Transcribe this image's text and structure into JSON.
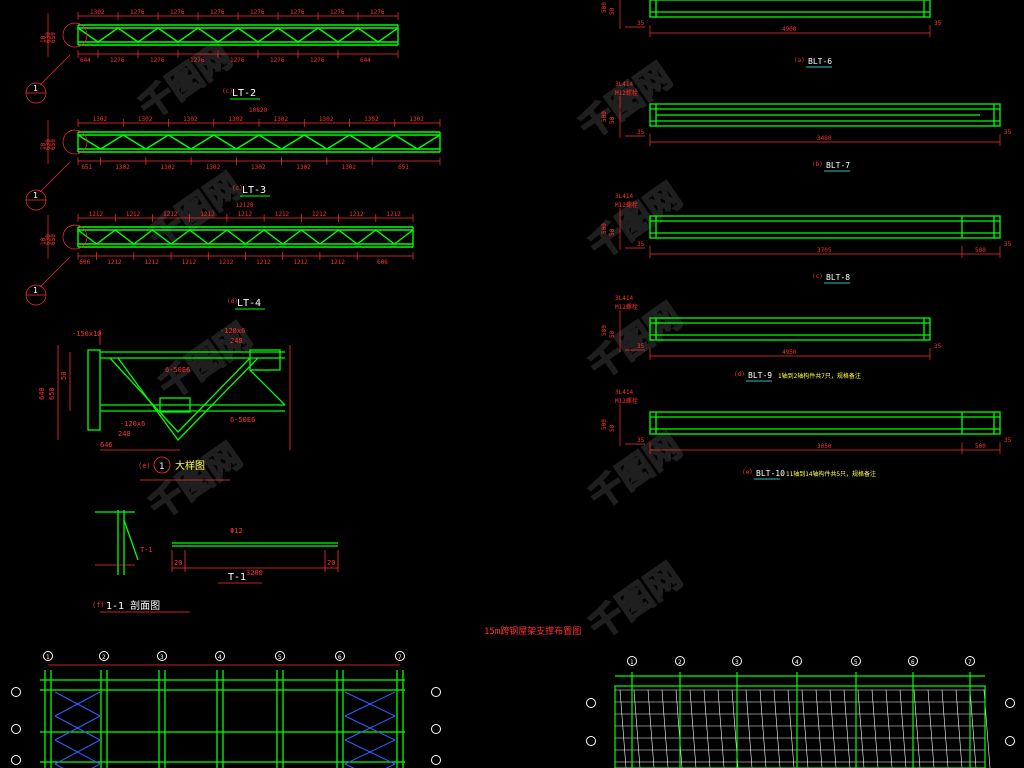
{
  "colors": {
    "background": "#000000",
    "truss": "#00ff00",
    "dimension": "#ff3030",
    "label": "#ffffff",
    "note": "#ffff40",
    "grid": "#40ffff",
    "bracing": "#3060ff"
  },
  "trusses": [
    {
      "label": "LT-2",
      "prefix": "(c)",
      "top_dims": [
        "1302",
        "1276",
        "1276",
        "1276",
        "1276",
        "1276",
        "1276",
        "1276"
      ],
      "bottom_dims": [
        "644",
        "1276",
        "1276",
        "1276",
        "1276",
        "1276",
        "1276",
        "644"
      ],
      "total": "",
      "height_dims": [
        "10",
        "630",
        "650"
      ]
    },
    {
      "label": "LT-3",
      "prefix": "(c)",
      "top_dims": [
        "1302",
        "1302",
        "1302",
        "1302",
        "1302",
        "1302",
        "1302",
        "1302"
      ],
      "bottom_dims": [
        "651",
        "1302",
        "1302",
        "1302",
        "1302",
        "1302",
        "1302",
        "651"
      ],
      "total": "10820",
      "height_dims": [
        "10",
        "630",
        "650"
      ]
    },
    {
      "label": "LT-4",
      "prefix": "(d)",
      "top_dims": [
        "1212",
        "1212",
        "1212",
        "1212",
        "1212",
        "1212",
        "1212",
        "1212",
        "1212"
      ],
      "bottom_dims": [
        "606",
        "1212",
        "1212",
        "1212",
        "1212",
        "1212",
        "1212",
        "1212",
        "606"
      ],
      "total": "12120",
      "height_dims": [
        "10",
        "630",
        "650"
      ]
    }
  ],
  "beams": [
    {
      "label": "BLT-6",
      "prefix": "(a)",
      "length": "4900",
      "end_dim": "",
      "left_notes": [],
      "tail_note": ""
    },
    {
      "label": "BLT-7",
      "prefix": "(b)",
      "length": "3480",
      "end_dim": "",
      "left_notes": [
        "3L414",
        "M12螺栓"
      ],
      "tail_note": ""
    },
    {
      "label": "BLT-8",
      "prefix": "(c)",
      "length": "3705",
      "end_dim": "500",
      "left_notes": [
        "3L414",
        "M12螺栓"
      ],
      "tail_note": ""
    },
    {
      "label": "BLT-9",
      "prefix": "(d)",
      "length": "4950",
      "end_dim": "",
      "left_notes": [
        "3L414",
        "M12螺栓"
      ],
      "tail_note": "1轴到2轴构件共7只，规格备注"
    },
    {
      "label": "BLT-10",
      "prefix": "(e)",
      "length": "3050",
      "end_dim": "500",
      "left_notes": [
        "3L414",
        "M12螺栓"
      ],
      "tail_note": "11轴到14轴构件共5只，规格备注"
    }
  ],
  "detail": {
    "caption": "大样图",
    "prefix": "(e)",
    "marker": "1",
    "top_notes": [
      "-150x10",
      "-120x6",
      "240"
    ],
    "side_dims": [
      "640",
      "650",
      "50"
    ],
    "bolt_note": "6-50E6",
    "bottom_notes": [
      "-120x6",
      "240",
      "646"
    ]
  },
  "section": {
    "caption": "1-1 剖面图",
    "prefix": "(f)",
    "tag": "T-1",
    "rod_label": "T-1",
    "rod_diameter": "Φ12",
    "rod_length": "3280",
    "rod_end_dims": [
      "20",
      "20"
    ]
  },
  "plan_title": "15m跨钢屋架支撑布置图",
  "grid_bubbles_left": [
    "1",
    "2",
    "3",
    "4",
    "5",
    "6",
    "7"
  ],
  "grid_bubbles_right": [
    "1",
    "2",
    "3",
    "4",
    "5",
    "6",
    "7",
    "8"
  ],
  "watermark": "千图网"
}
